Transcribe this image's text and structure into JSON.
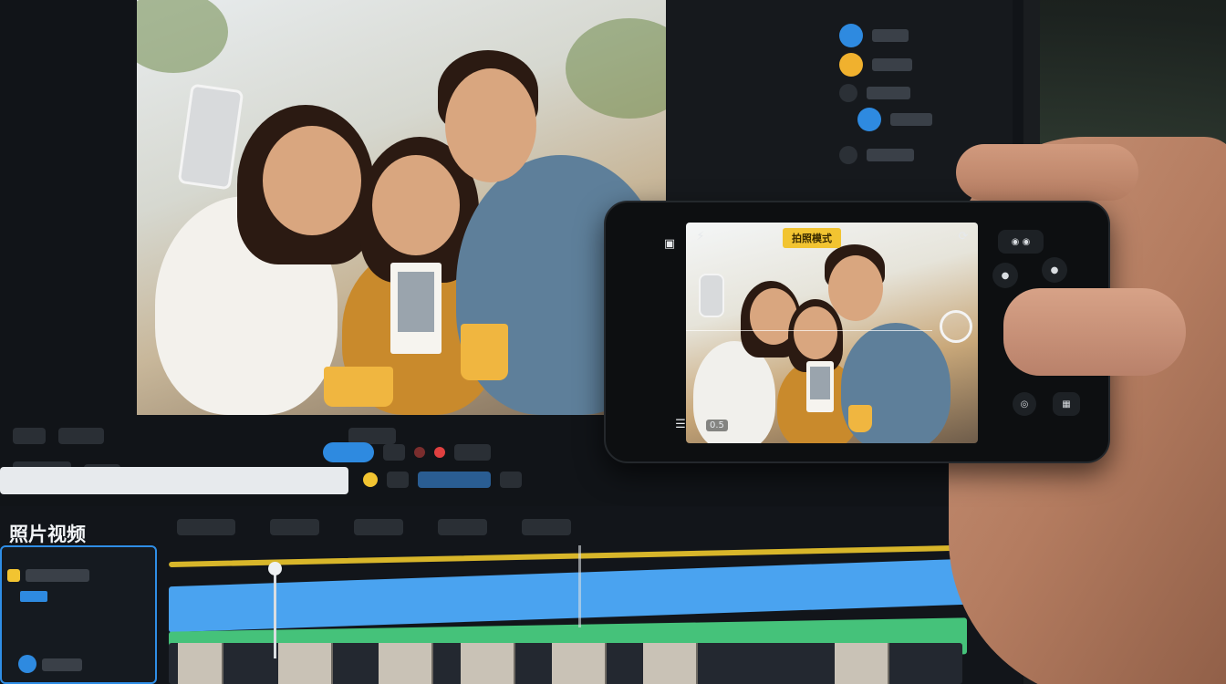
{
  "editor": {
    "panel_title": "照片视频"
  },
  "camera": {
    "mode_label": "拍照模式",
    "zoom": "0.5"
  },
  "colors": {
    "accent_blue": "#2e8ae0",
    "accent_yellow": "#f2c431",
    "timeline_yellow": "#d8b62a",
    "timeline_blue": "#4aa3f0",
    "timeline_green": "#45c27a"
  },
  "icons": {
    "shutter": "shutter-icon",
    "gallery": "gallery-icon",
    "flip": "flip-camera-icon",
    "settings": "settings-icon",
    "flash": "flash-icon"
  }
}
